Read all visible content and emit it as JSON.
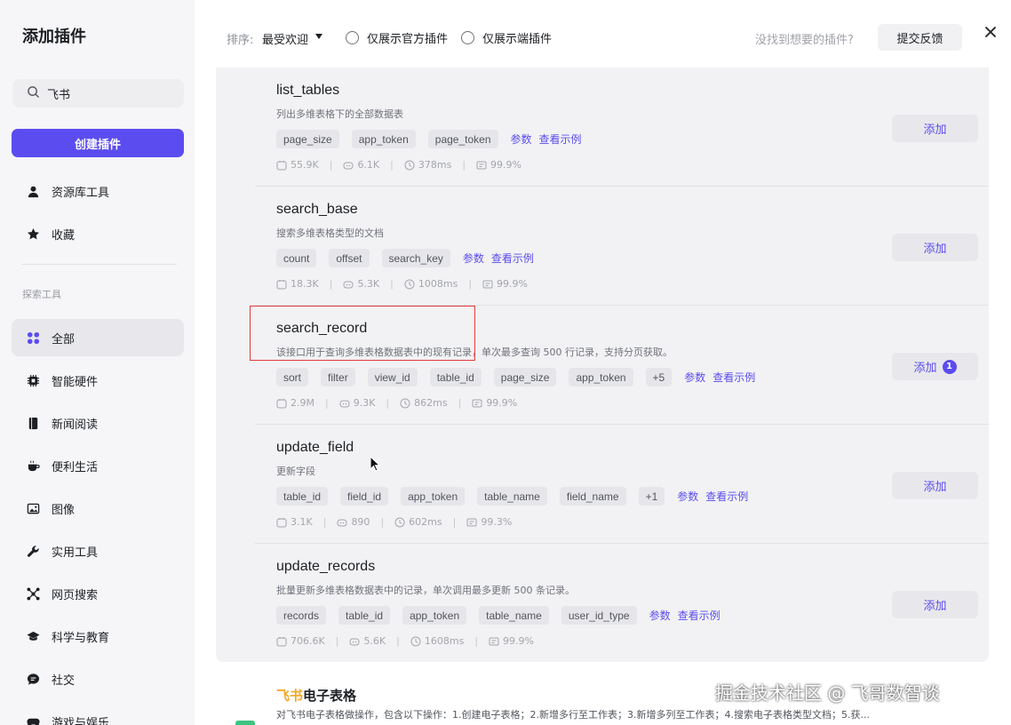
{
  "sidebar": {
    "title": "添加插件",
    "search_value": "飞书",
    "create_label": "创建插件",
    "top_items": [
      {
        "label": "资源库工具",
        "icon": "user-icon"
      },
      {
        "label": "收藏",
        "icon": "star-icon"
      }
    ],
    "section_label": "探索工具",
    "categories": [
      {
        "label": "全部",
        "icon": "grid-icon",
        "active": true
      },
      {
        "label": "智能硬件",
        "icon": "chip-icon"
      },
      {
        "label": "新闻阅读",
        "icon": "book-icon"
      },
      {
        "label": "便利生活",
        "icon": "cup-icon"
      },
      {
        "label": "图像",
        "icon": "image-icon"
      },
      {
        "label": "实用工具",
        "icon": "wrench-icon"
      },
      {
        "label": "网页搜索",
        "icon": "network-icon"
      },
      {
        "label": "科学与教育",
        "icon": "graduation-cap-icon"
      },
      {
        "label": "社交",
        "icon": "chat-icon"
      },
      {
        "label": "游戏与娱乐",
        "icon": "gamepad-icon"
      }
    ]
  },
  "topbar": {
    "sort_label": "排序:",
    "sort_value": "最受欢迎",
    "filter_official": "仅展示官方插件",
    "filter_client": "仅展示端插件",
    "hint": "没找到想要的插件?",
    "feedback_label": "提交反馈"
  },
  "tools": [
    {
      "name": "list_tables",
      "desc": "列出多维表格下的全部数据表",
      "tags": [
        "page_size",
        "app_token",
        "page_token"
      ],
      "params_label": "参数",
      "example_label": "查看示例",
      "stats": {
        "calls": "55.9K",
        "bots": "6.1K",
        "latency": "378ms",
        "success": "99.9%"
      },
      "add_label": "添加"
    },
    {
      "name": "search_base",
      "desc": "搜索多维表格类型的文档",
      "tags": [
        "count",
        "offset",
        "search_key"
      ],
      "params_label": "参数",
      "example_label": "查看示例",
      "stats": {
        "calls": "18.3K",
        "bots": "5.3K",
        "latency": "1008ms",
        "success": "99.9%"
      },
      "add_label": "添加"
    },
    {
      "name": "search_record",
      "desc": "该接口用于查询多维表格数据表中的现有记录，单次最多查询 500 行记录，支持分页获取。",
      "tags": [
        "sort",
        "filter",
        "view_id",
        "table_id",
        "page_size",
        "app_token",
        "+5"
      ],
      "params_label": "参数",
      "example_label": "查看示例",
      "stats": {
        "calls": "2.9M",
        "bots": "9.3K",
        "latency": "862ms",
        "success": "99.9%"
      },
      "add_label": "添加",
      "add_badge": "1"
    },
    {
      "name": "update_field",
      "desc": "更新字段",
      "tags": [
        "table_id",
        "field_id",
        "app_token",
        "table_name",
        "field_name",
        "+1"
      ],
      "params_label": "参数",
      "example_label": "查看示例",
      "stats": {
        "calls": "3.1K",
        "bots": "890",
        "latency": "602ms",
        "success": "99.3%"
      },
      "add_label": "添加"
    },
    {
      "name": "update_records",
      "desc": "批量更新多维表格数据表中的记录，单次调用最多更新 500 条记录。",
      "tags": [
        "records",
        "table_id",
        "app_token",
        "table_name",
        "user_id_type"
      ],
      "params_label": "参数",
      "example_label": "查看示例",
      "stats": {
        "calls": "706.6K",
        "bots": "5.6K",
        "latency": "1608ms",
        "success": "99.9%"
      },
      "add_label": "添加"
    }
  ],
  "next_plugin": {
    "brand": "飞书",
    "title_rest": "电子表格",
    "desc": "对飞书电子表格做操作，包含以下操作：1.创建电子表格；2.新增多行至工作表；3.新增多列至工作表；4.搜索电子表格类型文档；5.获..."
  },
  "watermark": "掘金技术社区 @ 飞哥数智谈",
  "colors": {
    "accent": "#5b4cf0",
    "highlight": "#e23a3a",
    "brand": "#f5a623"
  }
}
